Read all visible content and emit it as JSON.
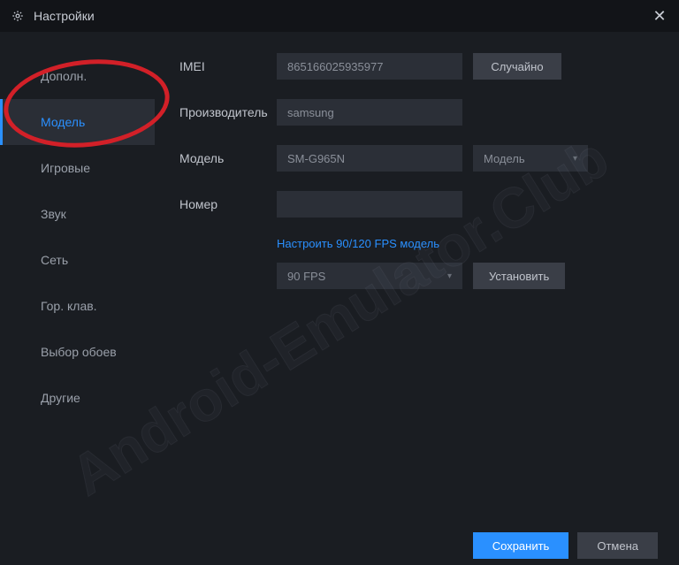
{
  "titlebar": {
    "title": "Настройки"
  },
  "sidebar": {
    "items": [
      {
        "label": "Дополн."
      },
      {
        "label": "Модель"
      },
      {
        "label": "Игровые"
      },
      {
        "label": "Звук"
      },
      {
        "label": "Сеть"
      },
      {
        "label": "Гор. клав."
      },
      {
        "label": "Выбор обоев"
      },
      {
        "label": "Другие"
      }
    ],
    "active_index": 1
  },
  "form": {
    "imei": {
      "label": "IMEI",
      "value": "865166025935977",
      "button": "Случайно"
    },
    "manufacturer": {
      "label": "Производитель",
      "value": "samsung"
    },
    "model": {
      "label": "Модель",
      "value": "SM-G965N",
      "select_label": "Модель"
    },
    "number": {
      "label": "Номер",
      "value": ""
    },
    "fps": {
      "link": "Настроить 90/120 FPS модель",
      "select_value": "90 FPS",
      "install_button": "Установить"
    }
  },
  "footer": {
    "save": "Сохранить",
    "cancel": "Отмена"
  },
  "watermark": "Android-Emulator.Club"
}
